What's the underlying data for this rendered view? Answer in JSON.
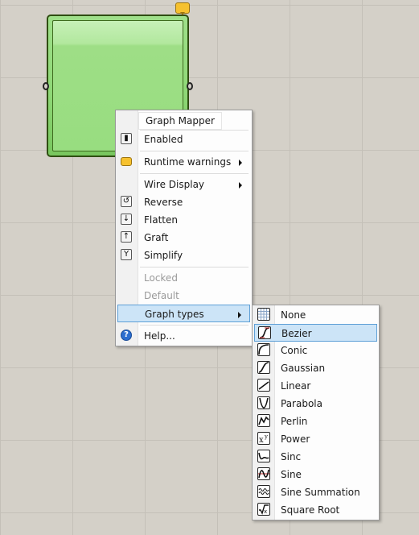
{
  "component": {
    "name": "Graph Mapper"
  },
  "context_menu": {
    "title": "Graph Mapper",
    "items": [
      {
        "label": "Enabled",
        "icon": "enabled-icon"
      },
      {
        "label": "Runtime warnings",
        "icon": "warning-balloon-icon",
        "submenu": true
      },
      {
        "label": "Wire Display",
        "submenu": true
      },
      {
        "label": "Reverse",
        "icon": "reverse-icon"
      },
      {
        "label": "Flatten",
        "icon": "flatten-icon"
      },
      {
        "label": "Graft",
        "icon": "graft-icon"
      },
      {
        "label": "Simplify",
        "icon": "simplify-icon"
      },
      {
        "label": "Locked",
        "disabled": true
      },
      {
        "label": "Default",
        "disabled": true
      },
      {
        "label": "Graph types",
        "submenu": true,
        "highlighted": true
      },
      {
        "label": "Help...",
        "icon": "help-icon"
      }
    ]
  },
  "graph_types_menu": {
    "items": [
      {
        "label": "None",
        "icon": "graph-none-icon"
      },
      {
        "label": "Bezier",
        "icon": "graph-bezier-icon",
        "highlighted": true
      },
      {
        "label": "Conic",
        "icon": "graph-conic-icon"
      },
      {
        "label": "Gaussian",
        "icon": "graph-gaussian-icon"
      },
      {
        "label": "Linear",
        "icon": "graph-linear-icon"
      },
      {
        "label": "Parabola",
        "icon": "graph-parabola-icon"
      },
      {
        "label": "Perlin",
        "icon": "graph-perlin-icon"
      },
      {
        "label": "Power",
        "icon": "graph-power-icon"
      },
      {
        "label": "Sinc",
        "icon": "graph-sinc-icon"
      },
      {
        "label": "Sine",
        "icon": "graph-sine-icon"
      },
      {
        "label": "Sine Summation",
        "icon": "graph-sine-summation-icon"
      },
      {
        "label": "Square Root",
        "icon": "graph-square-root-icon"
      }
    ]
  },
  "colors": {
    "canvas": "#d4d0c8",
    "component_fill": "#98dd80",
    "highlight": "#cce4f7",
    "highlight_border": "#5d9fd6"
  }
}
